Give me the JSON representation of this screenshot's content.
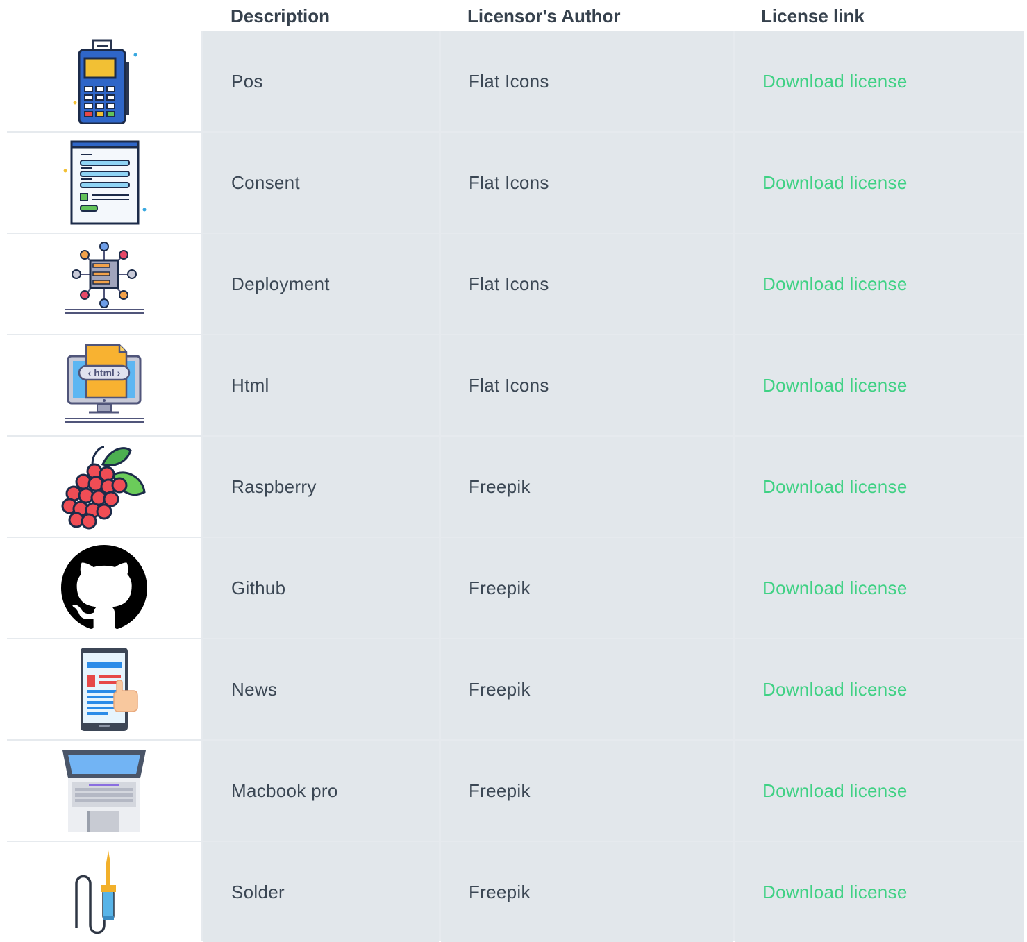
{
  "headers": {
    "description": "Description",
    "author": "Licensor's Author",
    "link": "License link"
  },
  "rows": [
    {
      "icon": "pos-terminal-icon",
      "description": "Pos",
      "author": "Flat Icons",
      "link": "Download license"
    },
    {
      "icon": "consent-form-icon",
      "description": "Consent",
      "author": "Flat Icons",
      "link": "Download license"
    },
    {
      "icon": "deployment-server-icon",
      "description": "Deployment",
      "author": "Flat Icons",
      "link": "Download license"
    },
    {
      "icon": "html-monitor-icon",
      "description": "Html",
      "author": "Flat Icons",
      "link": "Download license"
    },
    {
      "icon": "raspberry-icon",
      "description": "Raspberry",
      "author": "Freepik",
      "link": "Download license"
    },
    {
      "icon": "github-icon",
      "description": "Github",
      "author": "Freepik",
      "link": "Download license"
    },
    {
      "icon": "news-phone-icon",
      "description": "News",
      "author": "Freepik",
      "link": "Download license"
    },
    {
      "icon": "macbook-pro-icon",
      "description": "Macbook pro",
      "author": "Freepik",
      "link": "Download license"
    },
    {
      "icon": "soldering-iron-icon",
      "description": "Solder",
      "author": "Freepik",
      "link": "Download license"
    }
  ],
  "html_icon_text": "‹ html ›",
  "colors": {
    "header_text": "#36414d",
    "cell_bg": "#e2e7eb",
    "body_text": "#3b4754",
    "link_green": "#3fd184"
  }
}
